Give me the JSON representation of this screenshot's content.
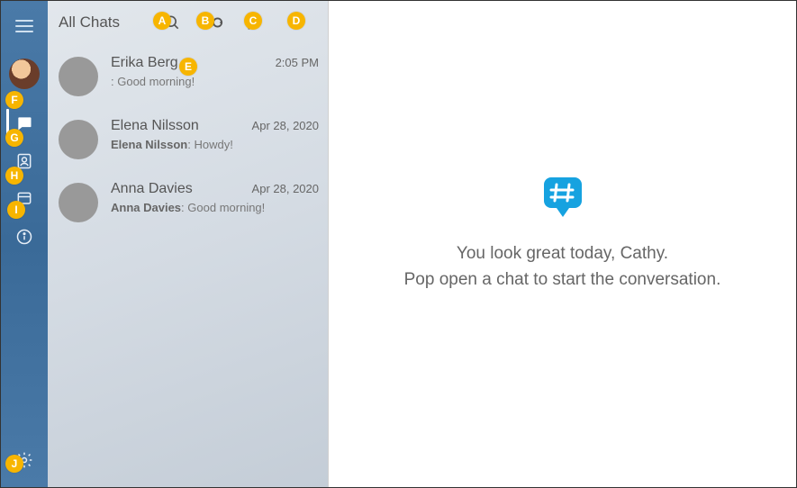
{
  "sidebar": {
    "nav": [
      {
        "name": "chats",
        "active": true
      },
      {
        "name": "contacts",
        "active": false
      },
      {
        "name": "channels",
        "active": false
      },
      {
        "name": "info",
        "active": false
      }
    ]
  },
  "header": {
    "title": "All Chats"
  },
  "toolbar": {
    "search": "search",
    "mark_read": "mark-read",
    "compose": "compose",
    "more": "more"
  },
  "chats": [
    {
      "name": "Erika Berg",
      "time": "2:05 PM",
      "sender": "",
      "preview": ": Good morning!"
    },
    {
      "name": "Elena Nilsson",
      "time": "Apr 28, 2020",
      "sender": "Elena Nilsson",
      "preview": "Howdy!"
    },
    {
      "name": "Anna Davies",
      "time": "Apr 28, 2020",
      "sender": "Anna Davies",
      "preview": "Good morning!"
    }
  ],
  "empty_state": {
    "line1": "You look great today, Cathy.",
    "line2": "Pop open a chat to start the conversation."
  },
  "callouts": {
    "A": "A",
    "B": "B",
    "C": "C",
    "D": "D",
    "E": "E",
    "F": "F",
    "G": "G",
    "H": "H",
    "I": "I",
    "J": "J"
  }
}
